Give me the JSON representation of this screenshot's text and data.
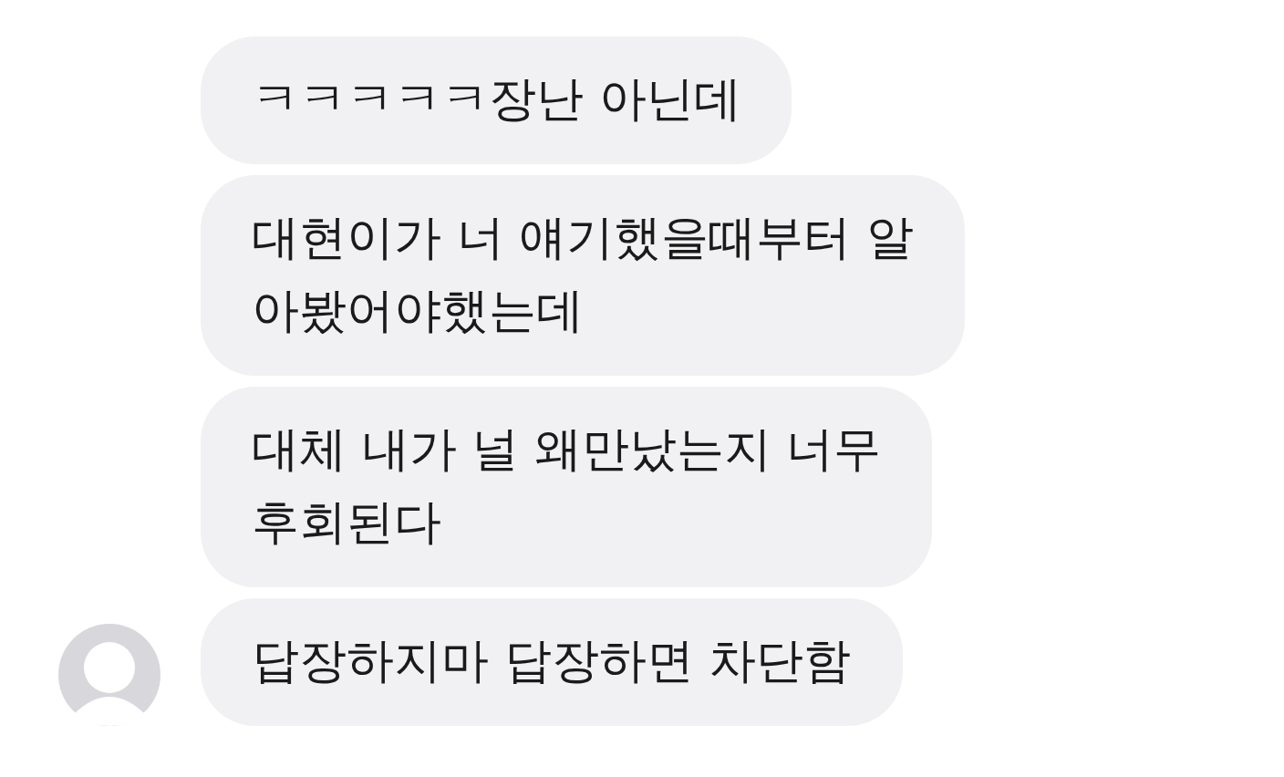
{
  "messages": [
    {
      "lines": [
        "ㅋㅋㅋㅋㅋ장난 아닌데"
      ],
      "avatar": false
    },
    {
      "lines": [
        "대현이가 너 얘기했을때부터 알",
        "아봤어야했는데"
      ],
      "avatar": false
    },
    {
      "lines": [
        "대체 내가 널 왜만났는지 너무",
        "후회된다"
      ],
      "avatar": false
    },
    {
      "lines": [
        "답장하지마 답장하면 차단함"
      ],
      "avatar": true
    }
  ]
}
